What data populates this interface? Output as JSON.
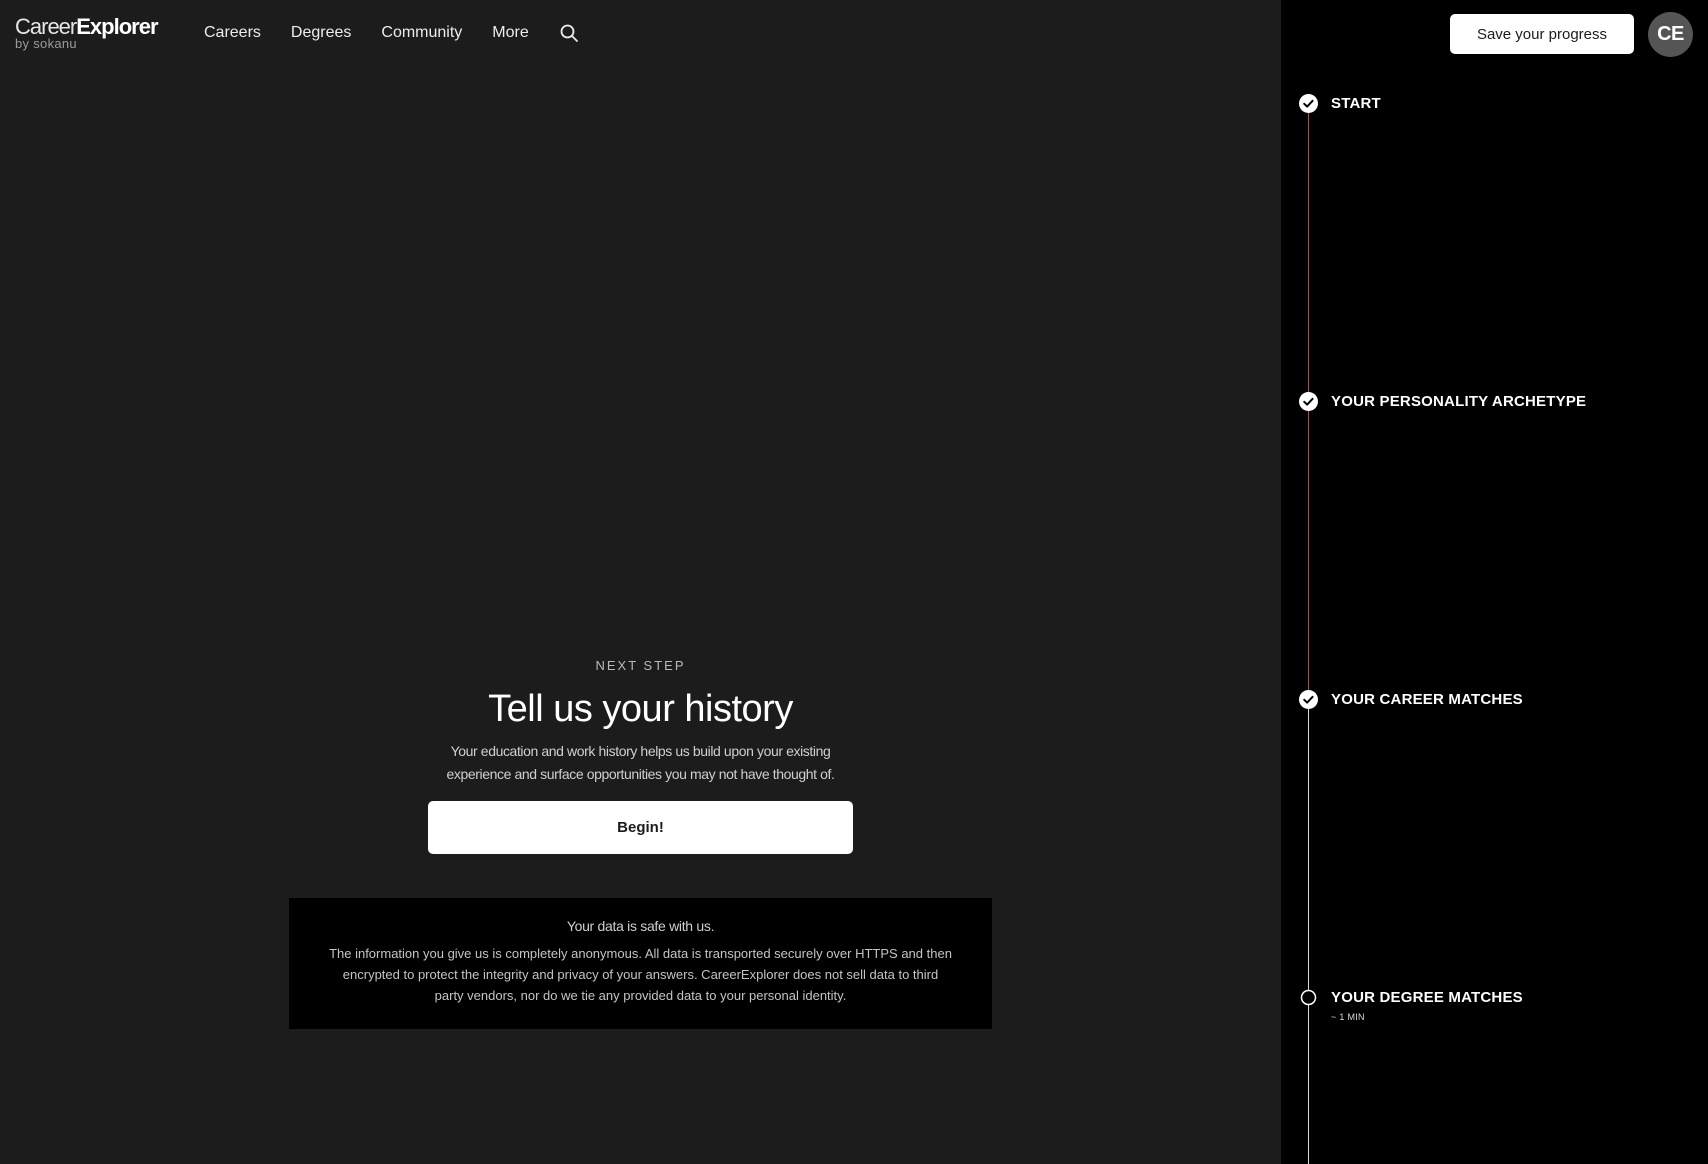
{
  "brand": {
    "name_light": "Career",
    "name_bold": "Explorer",
    "sub": "by sokanu"
  },
  "nav": {
    "items": [
      {
        "label": "Careers"
      },
      {
        "label": "Degrees"
      },
      {
        "label": "Community"
      },
      {
        "label": "More"
      }
    ],
    "search_icon": "search-icon"
  },
  "main": {
    "eyebrow": "NEXT STEP",
    "title": "Tell us your history",
    "description": "Your education and work history helps us build upon your existing experience and surface opportunities you may not have thought of.",
    "begin_label": "Begin!"
  },
  "privacy": {
    "title": "Your data is safe with us.",
    "body": "The information you give us is completely anonymous. All data is transported securely over HTTPS and then encrypted to protect the integrity and privacy of your answers. CareerExplorer does not sell data to third party vendors, nor do we tie any provided data to your personal identity."
  },
  "header_right": {
    "save_label": "Save your progress",
    "avatar_initials": "CE"
  },
  "timeline": {
    "steps": [
      {
        "label": "START",
        "status": "complete"
      },
      {
        "label": "YOUR PERSONALITY ARCHETYPE",
        "status": "complete"
      },
      {
        "label": "YOUR CAREER MATCHES",
        "status": "complete"
      },
      {
        "label": "YOUR DEGREE MATCHES",
        "status": "pending",
        "sub": "~ 1 MIN"
      }
    ],
    "colors": {
      "complete_line": "#b24a55",
      "pending_line": "#d9d9d9"
    }
  },
  "colors": {
    "background": "#1c1c1c",
    "panel": "#000000",
    "button": "#ffffff"
  }
}
